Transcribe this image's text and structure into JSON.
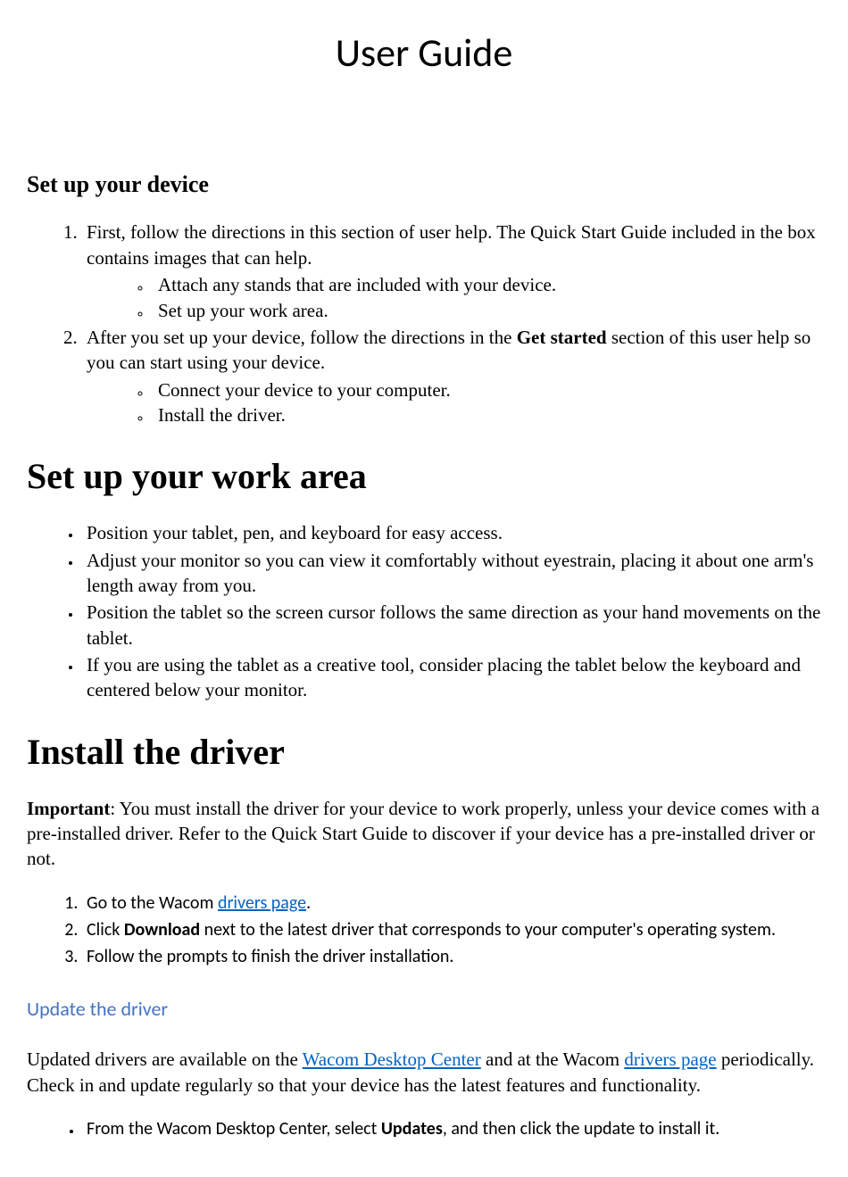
{
  "title": "User Guide",
  "setup_device": {
    "heading": "Set up your device",
    "item1_text_a": "First, follow the directions in this section of user help. The Quick Start Guide included in the box contains images that can help.",
    "item1_sub_a": "Attach any stands that are included with your device.",
    "item1_sub_b": "Set up your work area.",
    "item2_text_a": "After you set up your device, follow the directions in the ",
    "item2_bold": "Get started",
    "item2_text_b": " section of this user help so you can start using your device.",
    "item2_sub_a": "Connect your device to your computer.",
    "item2_sub_b": "Install the driver."
  },
  "work_area": {
    "heading": "Set up your work area",
    "bullet1": "Position your tablet, pen, and keyboard for easy access.",
    "bullet2": "Adjust your monitor so you can view it comfortably without eyestrain, placing it about one arm's length away from you.",
    "bullet3": "Position the tablet so the screen cursor follows the same direction as your hand movements on the tablet.",
    "bullet4": "If you are using the tablet as a creative tool, consider placing the tablet below the keyboard and centered below your monitor."
  },
  "install_driver": {
    "heading": "Install the driver",
    "important_label": "Important",
    "important_text": ": You must install the driver for your device to work properly, unless your device comes with a pre-installed driver. Refer to the Quick Start Guide to discover if your device has a pre-installed driver or not.",
    "step1_a": "Go to the Wacom ",
    "step1_link": "drivers page",
    "step1_b": ".",
    "step2_a": "Click ",
    "step2_bold": "Download",
    "step2_b": " next to the latest driver that corresponds to your computer's operating system.",
    "step3": "Follow the prompts to finish the driver installation."
  },
  "update_driver": {
    "heading": "Update the driver",
    "para_a": "Updated drivers are available on the ",
    "link1": "Wacom Desktop Center",
    "para_b": " and at the Wacom ",
    "link2": "drivers page",
    "para_c": " periodically. Check in and update regularly so that your device has the latest features and functionality.",
    "bullet_a": "From the Wacom Desktop Center, select ",
    "bullet_bold": "Updates",
    "bullet_b": ", and then click the update to install it."
  }
}
